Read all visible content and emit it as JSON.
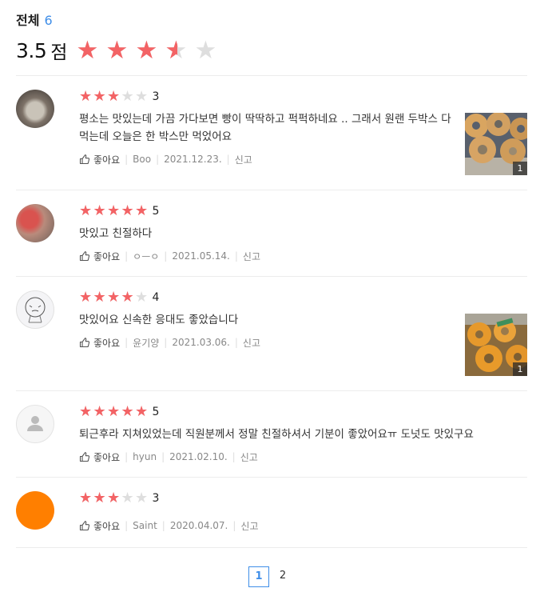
{
  "summary": {
    "total_label": "전체",
    "total_count": "6",
    "score": "3.5",
    "score_unit": "점",
    "rating": 3.5,
    "max_rating": 5
  },
  "colors": {
    "star_filled": "#f36365",
    "star_empty": "#dedede",
    "accent": "#3f8ee8"
  },
  "reviews": [
    {
      "rating": 3,
      "rating_text": "3",
      "text": "평소는 맛있는데 가끔 가다보면 빵이 딱딱하고 퍽퍽하네요 .. 그래서 원랜 두박스 다 먹는데 오늘은 한 박스만 먹었어요",
      "like_label": "좋아요",
      "author": "Boo",
      "date": "2021.12.23.",
      "report_label": "신고",
      "photo_count": "1"
    },
    {
      "rating": 5,
      "rating_text": "5",
      "text": "맛있고 친절하다",
      "like_label": "좋아요",
      "author": "ㅇㅡㅇ",
      "date": "2021.05.14.",
      "report_label": "신고"
    },
    {
      "rating": 4,
      "rating_text": "4",
      "text": "맛있어요 신속한 응대도 좋았습니다",
      "like_label": "좋아요",
      "author": "윤기양",
      "date": "2021.03.06.",
      "report_label": "신고",
      "photo_count": "1"
    },
    {
      "rating": 5,
      "rating_text": "5",
      "text": "퇴근후라 지쳐있었는데 직원분께서 정말 친절하셔서 기분이 좋았어요ㅠ 도넛도 맛있구요",
      "like_label": "좋아요",
      "author": "hyun",
      "date": "2021.02.10.",
      "report_label": "신고"
    },
    {
      "rating": 3,
      "rating_text": "3",
      "text": "",
      "like_label": "좋아요",
      "author": "Saint",
      "date": "2020.04.07.",
      "report_label": "신고"
    }
  ],
  "pagination": {
    "pages": [
      "1",
      "2"
    ],
    "current": "1"
  }
}
